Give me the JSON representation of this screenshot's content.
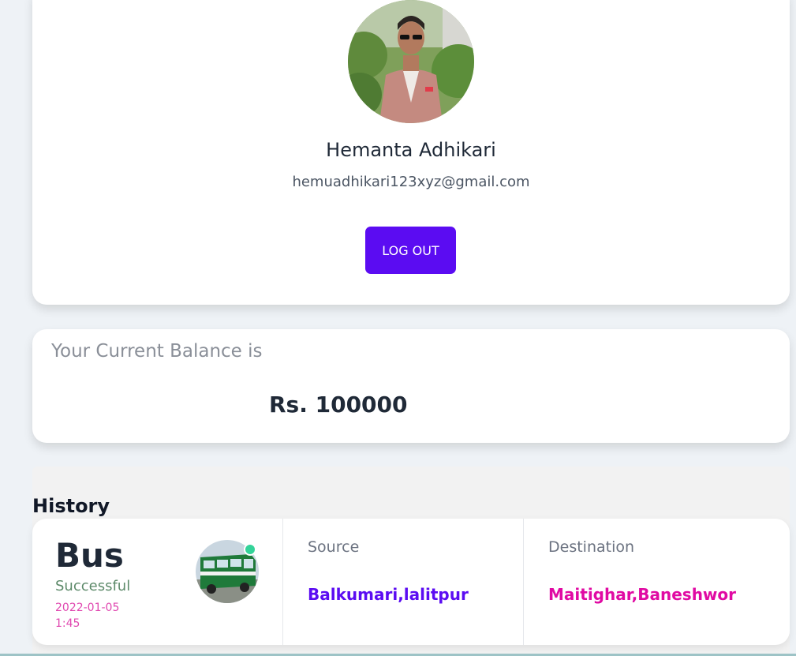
{
  "profile": {
    "name": "Hemanta Adhikari",
    "email": "hemuadhikari123xyz@gmail.com",
    "logout_label": "LOG OUT"
  },
  "balance": {
    "label": "Your Current Balance is",
    "value": "Rs. 100000"
  },
  "history": {
    "title": "History",
    "entries": [
      {
        "mode": "Bus",
        "status": "Successful",
        "date": "2022-01-05",
        "time": "1:45",
        "source_label": "Source",
        "source": "Balkumari,lalitpur",
        "destination_label": "Destination",
        "destination": "Maitighar,Baneshwor"
      }
    ]
  },
  "colors": {
    "accent": "#5b0cf2",
    "destination": "#e00aa3",
    "status": "#5d8a6a",
    "date": "#e048b0"
  }
}
